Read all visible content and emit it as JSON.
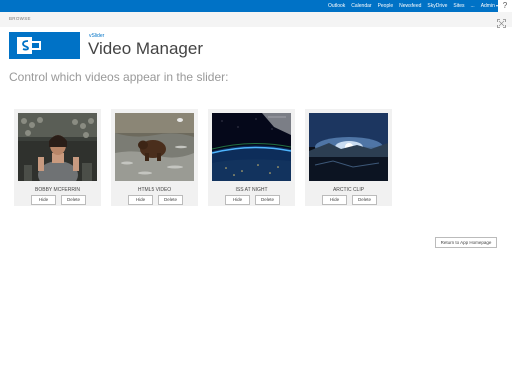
{
  "suitebar": {
    "links": [
      "Outlook",
      "Calendar",
      "People",
      "Newsfeed",
      "SkyDrive",
      "Sites",
      "...",
      "Admin"
    ],
    "help_icon": "question-mark-icon",
    "accent": "#0072c6"
  },
  "ribbon": {
    "tab": "BROWSE",
    "focus_icon": "focus-on-content-icon"
  },
  "header": {
    "logo_icon": "sharepoint-logo-icon",
    "app_link": "vSlider",
    "title": "Video Manager"
  },
  "main": {
    "subtitle": "Control which videos appear in the slider:",
    "videos": [
      {
        "title": "BOBBY MCFERRIN",
        "hide_label": "Hide",
        "delete_label": "Delete",
        "thumbnail": "man-singing-thumbnail"
      },
      {
        "title": "HTML5 VIDEO",
        "hide_label": "Hide",
        "delete_label": "Delete",
        "thumbnail": "bear-in-river-thumbnail"
      },
      {
        "title": "ISS AT NIGHT",
        "hide_label": "Hide",
        "delete_label": "Delete",
        "thumbnail": "earth-from-space-thumbnail"
      },
      {
        "title": "ARCTIC CLIP",
        "hide_label": "Hide",
        "delete_label": "Delete",
        "thumbnail": "arctic-sun-thumbnail"
      }
    ],
    "return_label": "Return to App Homepage"
  }
}
